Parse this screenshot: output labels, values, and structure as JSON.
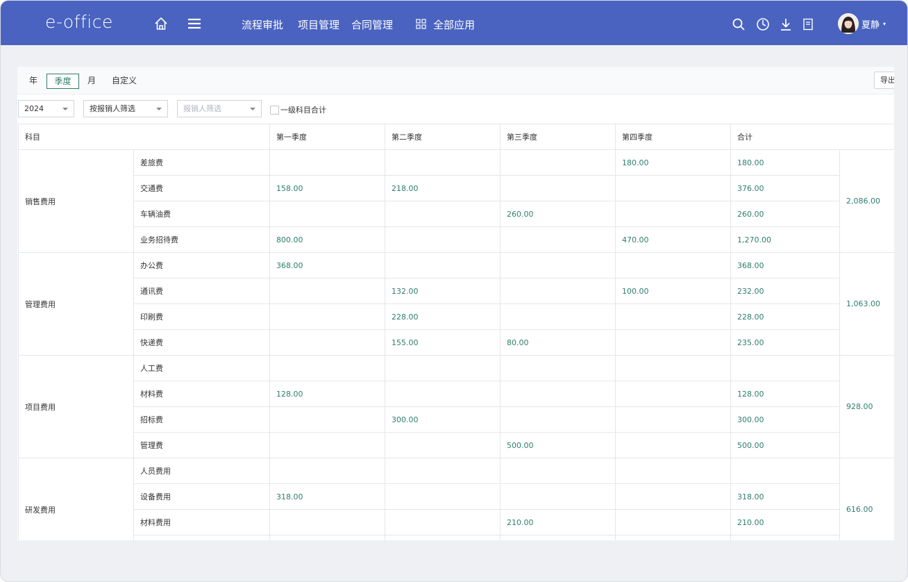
{
  "header": {
    "logo": "e-office",
    "nav": [
      "流程审批",
      "项目管理",
      "合同管理"
    ],
    "all_apps": "全部应用",
    "user_name": "夏静",
    "icons": [
      "home-icon",
      "menu-icon",
      "grid-icon",
      "search-icon",
      "clock-icon",
      "download-icon",
      "document-icon"
    ]
  },
  "tabs": {
    "items": [
      "年",
      "季度",
      "月",
      "自定义"
    ],
    "active": "季度",
    "export_label": "导出"
  },
  "filters": {
    "year": "2024",
    "filter_mode": "按报销人筛选",
    "reporter_placeholder": "报销人筛选",
    "checkbox_label": "一级科目合计",
    "checkbox_checked": false
  },
  "table": {
    "headers": [
      "科目",
      "第一季度",
      "第二季度",
      "第三季度",
      "第四季度",
      "合计"
    ],
    "groups": [
      {
        "category": "销售费用",
        "total": "2,086.00",
        "rows": [
          {
            "item": "差旅费",
            "q1": "",
            "q2": "",
            "q3": "",
            "q4": "180.00",
            "sum": "180.00"
          },
          {
            "item": "交通费",
            "q1": "158.00",
            "q2": "218.00",
            "q3": "",
            "q4": "",
            "sum": "376.00"
          },
          {
            "item": "车辆油费",
            "q1": "",
            "q2": "",
            "q3": "260.00",
            "q4": "",
            "sum": "260.00"
          },
          {
            "item": "业务招待费",
            "q1": "800.00",
            "q2": "",
            "q3": "",
            "q4": "470.00",
            "sum": "1,270.00"
          }
        ]
      },
      {
        "category": "管理费用",
        "total": "1,063.00",
        "rows": [
          {
            "item": "办公费",
            "q1": "368.00",
            "q2": "",
            "q3": "",
            "q4": "",
            "sum": "368.00"
          },
          {
            "item": "通讯费",
            "q1": "",
            "q2": "132.00",
            "q3": "",
            "q4": "100.00",
            "sum": "232.00"
          },
          {
            "item": "印刷费",
            "q1": "",
            "q2": "228.00",
            "q3": "",
            "q4": "",
            "sum": "228.00"
          },
          {
            "item": "快递费",
            "q1": "",
            "q2": "155.00",
            "q3": "80.00",
            "q4": "",
            "sum": "235.00"
          }
        ]
      },
      {
        "category": "项目费用",
        "total": "928.00",
        "rows": [
          {
            "item": "人工费",
            "q1": "",
            "q2": "",
            "q3": "",
            "q4": "",
            "sum": ""
          },
          {
            "item": "材料费",
            "q1": "128.00",
            "q2": "",
            "q3": "",
            "q4": "",
            "sum": "128.00"
          },
          {
            "item": "招标费",
            "q1": "",
            "q2": "300.00",
            "q3": "",
            "q4": "",
            "sum": "300.00"
          },
          {
            "item": "管理费",
            "q1": "",
            "q2": "",
            "q3": "500.00",
            "q4": "",
            "sum": "500.00"
          }
        ]
      },
      {
        "category": "研发费用",
        "total": "616.00",
        "rows": [
          {
            "item": "人员费用",
            "q1": "",
            "q2": "",
            "q3": "",
            "q4": "",
            "sum": ""
          },
          {
            "item": "设备费用",
            "q1": "318.00",
            "q2": "",
            "q3": "",
            "q4": "",
            "sum": "318.00"
          },
          {
            "item": "材料费用",
            "q1": "",
            "q2": "",
            "q3": "210.00",
            "q4": "",
            "sum": "210.00"
          },
          {
            "item": "",
            "q1": "",
            "q2": "",
            "q3": "",
            "q4": "",
            "sum": ""
          }
        ]
      }
    ]
  },
  "colors": {
    "header_bg": "#4a63c0",
    "accent_green": "#2f7d6b",
    "page_bg": "#eef0f4"
  }
}
